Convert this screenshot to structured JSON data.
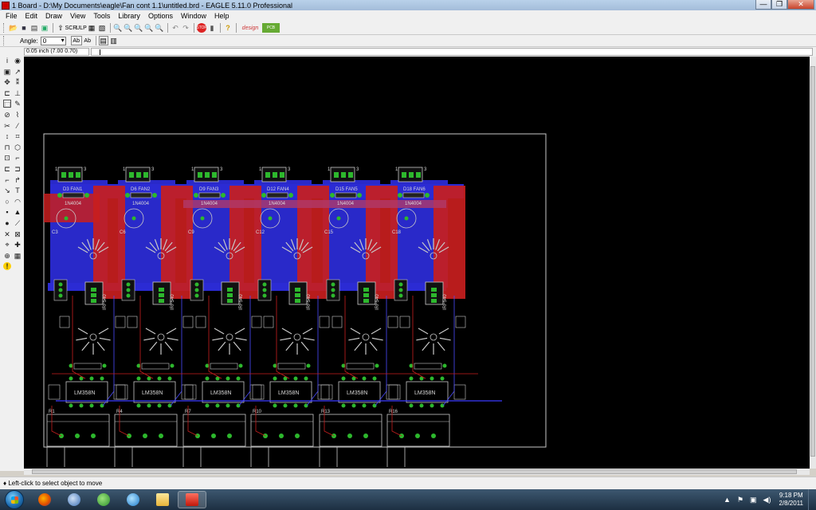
{
  "window": {
    "title": "1 Board - D:\\My Documents\\eagle\\Fan cont 1.1\\untitled.brd - EAGLE 5.11.0 Professional",
    "minimize": "—",
    "maximize": "❐",
    "close": "✕"
  },
  "menu": [
    "File",
    "Edit",
    "Draw",
    "View",
    "Tools",
    "Library",
    "Options",
    "Window",
    "Help"
  ],
  "toolbar2": {
    "angle_label": "Angle:",
    "angle_value": "0"
  },
  "coordinate": "0.05 inch (7.00 0.70)",
  "command_input": "",
  "board": {
    "diodes": [
      "D3",
      "D6",
      "D9",
      "D12",
      "D15",
      "D18"
    ],
    "fan_labels": [
      "FAN1",
      "FAN2",
      "FAN3",
      "FAN4",
      "FAN5",
      "FAN6"
    ],
    "diode_values": [
      "1N4004",
      "1N4004",
      "1N4004",
      "1N4004",
      "1N4004",
      "1N4004"
    ],
    "caps": [
      "C3",
      "C6",
      "C9",
      "C12",
      "C15",
      "C18"
    ],
    "mosfets": [
      "IRF540",
      "IRF540",
      "IRF540",
      "IRF540",
      "IRF540",
      "IRF540"
    ],
    "opamps": [
      "LM358N",
      "LM358N",
      "LM358N",
      "LM358N",
      "LM358N",
      "LM358N"
    ],
    "resistors": [
      "R1",
      "R4",
      "R7",
      "R10",
      "R13",
      "R16"
    ]
  },
  "status": "Left-click to select object to move",
  "taskbar": {
    "time": "9:18 PM",
    "date": "2/8/2011"
  },
  "colors": {
    "top_layer": "#c81e1e",
    "bottom_layer": "#2b2bd4",
    "pad": "#2db82d",
    "silkscreen": "#c8c8c8",
    "background": "#000000"
  }
}
